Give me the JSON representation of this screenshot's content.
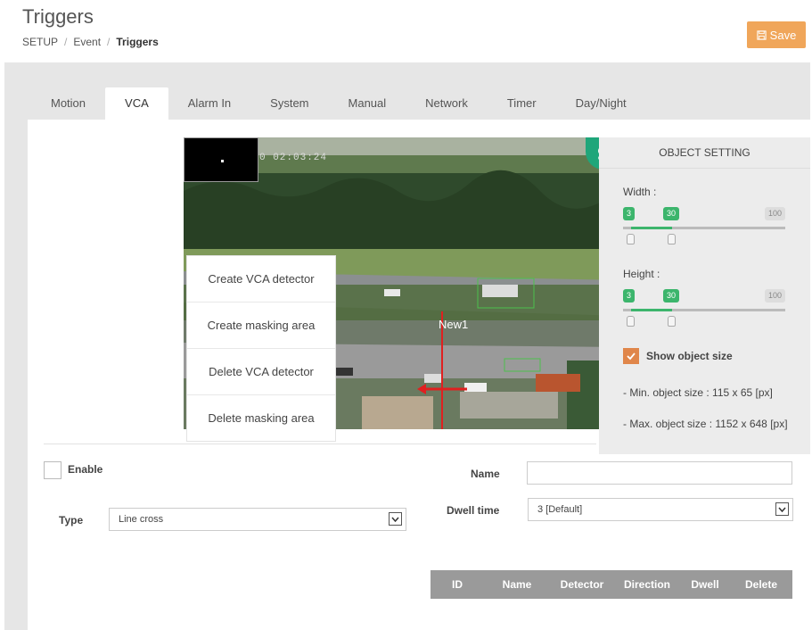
{
  "header": {
    "title": "Triggers",
    "breadcrumb": [
      "SETUP",
      "Event",
      "Triggers"
    ],
    "save_label": "Save"
  },
  "tabs": [
    {
      "label": "Motion"
    },
    {
      "label": "VCA",
      "active": true
    },
    {
      "label": "Alarm In"
    },
    {
      "label": "System"
    },
    {
      "label": "Manual"
    },
    {
      "label": "Network"
    },
    {
      "label": "Timer"
    },
    {
      "label": "Day/Night"
    }
  ],
  "video": {
    "osd_time": "0 02:03:24",
    "detector_label": "New1"
  },
  "context_menu": [
    "Create VCA detector",
    "Create masking area",
    "Delete VCA detector",
    "Delete masking area"
  ],
  "object_setting": {
    "title": "OBJECT SETTING",
    "width": {
      "label": "Width :",
      "min": "3",
      "max": "30",
      "scale_max": "100",
      "min_value": 3,
      "max_value": 30
    },
    "height": {
      "label": "Height :",
      "min": "3",
      "max": "30",
      "scale_max": "100",
      "min_value": 3,
      "max_value": 30
    },
    "show_object_size": {
      "label": "Show object size",
      "checked": true
    },
    "min_size_text": "- Min. object size : 115 x 65 [px]",
    "max_size_text": "- Max. object size : 1152 x 648 [px]"
  },
  "form": {
    "enable_label": "Enable",
    "enable_checked": false,
    "type_label": "Type",
    "type_value": "Line cross",
    "name_label": "Name",
    "name_value": "",
    "dwell_label": "Dwell time",
    "dwell_value": "3 [Default]"
  },
  "table": {
    "columns": [
      "ID",
      "Name",
      "Detector",
      "Direction",
      "Dwell",
      "Delete"
    ]
  },
  "colors": {
    "accent_orange": "#f0a65a",
    "checkbox_orange": "#e0864a",
    "slider_green": "#3cb56c",
    "gear_green": "#1fa67a"
  }
}
